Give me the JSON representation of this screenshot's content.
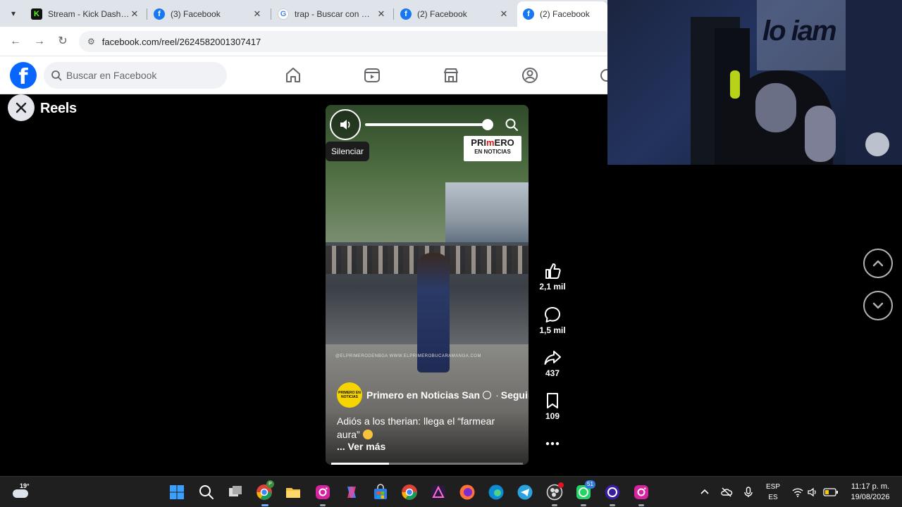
{
  "browser": {
    "tabs": [
      {
        "title": "Stream - Kick Dashboard",
        "icon": "kick-icon",
        "color": "#53fc18"
      },
      {
        "title": "(3) Facebook",
        "icon": "facebook-icon",
        "color": "#1877f2"
      },
      {
        "title": "trap - Buscar con Google",
        "icon": "google-icon",
        "color": "#4285f4"
      },
      {
        "title": "(2) Facebook",
        "icon": "facebook-icon",
        "color": "#1877f2"
      },
      {
        "title": "(2) Facebook",
        "icon": "facebook-icon",
        "color": "#1877f2"
      }
    ],
    "active_tab": 4,
    "url": "facebook.com/reel/2624582001307417"
  },
  "facebook": {
    "logo": "f",
    "search_placeholder": "Buscar en Facebook",
    "nav": [
      "home-icon",
      "video-icon",
      "marketplace-icon",
      "groups-icon"
    ],
    "brand_color": "#0866ff"
  },
  "reels": {
    "title": "Reels",
    "tooltip": "Silenciar",
    "badge_line1_a": "PRI",
    "badge_line1_b": "m",
    "badge_line1_c": "ERO",
    "badge_line2": "EN NOTICIAS",
    "watermark": "@ELPRIMERODENBGA   WWW.ELPRIMEROBUCARAMANGA.COM",
    "author_avatar_text": "PRIMERO EN NOTICIAS",
    "author": "Primero en Noticias San",
    "follow": "Seguir",
    "follow_sep": "·",
    "caption": "Adiós a los therian: llega el “farmear aura”",
    "see_more": "... Ver más",
    "progress": 0.3,
    "volume": 0.95,
    "actions": {
      "likes": "2,1 mil",
      "comments": "1,5 mil",
      "shares": "437",
      "saves": "109"
    }
  },
  "taskbar": {
    "temperature": "19°",
    "lang_top": "ESP",
    "lang_bottom": "ES",
    "time": "11:17 p. m.",
    "date": "19/08/2026",
    "chat_badge": "51",
    "profile_badge": "P"
  },
  "webcam": {
    "sign": "lo iam"
  }
}
